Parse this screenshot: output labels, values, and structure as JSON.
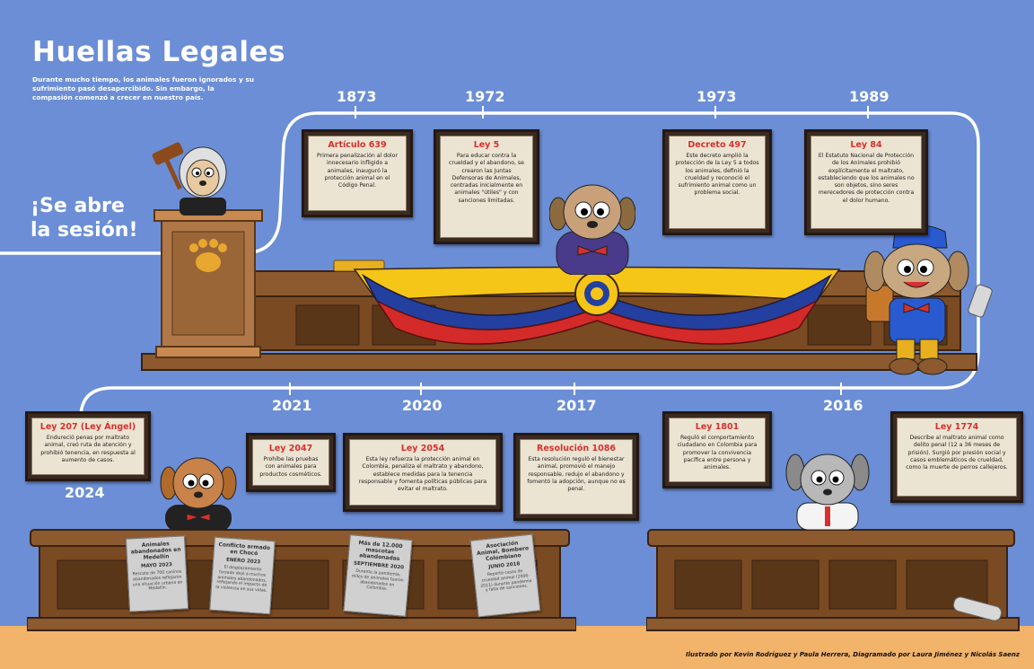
{
  "title": "Huellas Legales",
  "intro": "Durante mucho tiempo, los animales fueron ignorados y su sufrimiento pasó desapercibido. Sin embargo, la compasión comenzó a crecer en nuestro país.",
  "session_line1": "¡Se abre",
  "session_line2": "la sesión!",
  "colors": {
    "background": "#6b8ed6",
    "wood": "#8c5a2e",
    "wood_dark": "#5a3618",
    "frame": "#3a2a20",
    "accent_red": "#d8302c",
    "flag_yellow": "#f5c518",
    "flag_blue": "#2340a0",
    "flag_red": "#d42a2a",
    "floor": "#f2b36b"
  },
  "events": [
    {
      "year": "1873",
      "title": "Artículo 639",
      "body": "Primera penalización al dolor innecesario infligido a animales, inauguró la protección animal en el Código Penal."
    },
    {
      "year": "1972",
      "title": "Ley 5",
      "body": "Para educar contra la crueldad y el abandono, se crearon las Juntas Defensoras de Animales, centradas inicialmente en animales \"útiles\" y con sanciones limitadas."
    },
    {
      "year": "1973",
      "title": "Decreto 497",
      "body": "Este decreto amplió la protección de la Ley 5 a todos los animales, definió la crueldad y reconoció el sufrimiento animal como un problema social."
    },
    {
      "year": "1989",
      "title": "Ley 84",
      "body": "El Estatuto Nacional de Protección de los Animales prohibió explícitamente el maltrato, estableciendo que los animales no son objetos, sino seres merecedores de protección contra el dolor humano."
    },
    {
      "year": "2016",
      "title": "Ley 1774",
      "body": "Describe al maltrato animal como delito penal (12 a 36 meses de prisión). Surgió por presión social y casos emblemáticos de crueldad, como la muerte de perros callejeros."
    },
    {
      "year": "",
      "title": "Ley 1801",
      "body": "Reguló el comportamiento ciudadano en Colombia para promover la convivencia pacífica entre persona y animales."
    },
    {
      "year": "2017",
      "title": "Resolución 1086",
      "body": "Esta resolución reguló el bienestar animal, promovió el manejo responsable, redujo el abandono y fomentó la adopción, aunque no es penal."
    },
    {
      "year": "2020",
      "title": "Ley 2054",
      "body": "Esta ley refuerza la protección animal en Colombia, penaliza el maltrato y abandono, establece medidas para la tenencia responsable y fomenta políticas públicas para evitar el maltrato."
    },
    {
      "year": "2021",
      "title": "Ley 2047",
      "body": "Prohíbe las pruebas con animales para productos cosméticos."
    },
    {
      "year": "2024",
      "title": "Ley 207 (Ley Ángel)",
      "body": "Endureció penas por maltrato animal, creó ruta de atención y prohibió tenencia, en respuesta al aumento de casos."
    }
  ],
  "notes": [
    {
      "title": "Animales abandonados en Medellín",
      "date": "MAYO 2023",
      "body": "Rescate de 700 caninos abandonados reflejaron una situación urbana en Medellín."
    },
    {
      "title": "Conflicto armado en Chocó",
      "date": "ENERO 2023",
      "body": "El desplazamiento forzado dejó a muchos animales abandonados, reflejando el impacto de la violencia en sus vidas."
    },
    {
      "title": "Más de 12.000 mascotas abandonadas",
      "date": "SEPTIEMBRE 2020",
      "body": "Durante la pandemia, miles de animales fueron abandonados en Colombia."
    },
    {
      "title": "Asociación Animal, Bombero Colombiano",
      "date": "JUNIO 2018",
      "body": "Reportó casos de crueldad animal (2006-2011) durante pandemia y falta de sanciones."
    }
  ],
  "credits": "Ilustrado por Kevin Rodríguez y Paula Herrera, Diagramado por Laura Jiménez y Nicolás Saenz"
}
